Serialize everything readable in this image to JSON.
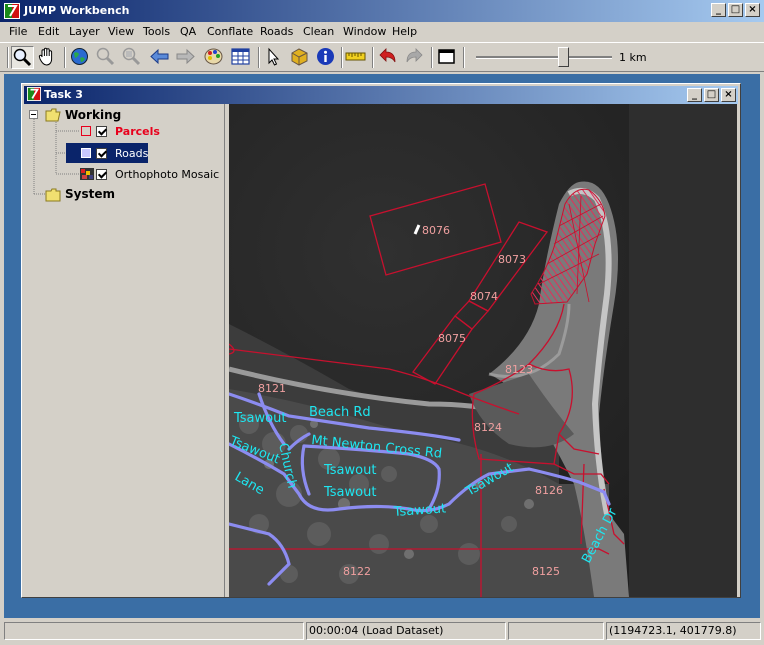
{
  "app": {
    "title": "JUMP Workbench",
    "window_buttons": [
      "_",
      "□",
      "×"
    ]
  },
  "menu": [
    "File",
    "Edit",
    "Layer",
    "View",
    "Tools",
    "QA",
    "Conflate",
    "Roads",
    "Clean",
    "Window",
    "Help"
  ],
  "toolbar": {
    "buttons": [
      "zoom-in-icon",
      "pan-hand-icon",
      "globe-icon",
      "zoom-to-selected-icon",
      "zoom-to-layer-icon",
      "back-arrow-icon",
      "forward-arrow-icon",
      "layer-palette-icon",
      "attribute-table-icon",
      "select-arrow-icon",
      "feature-box-icon",
      "info-icon",
      "measure-ruler-icon",
      "undo-icon",
      "redo-icon",
      "window-icon"
    ],
    "scale_label": "1 km",
    "scale_slider_value": 0.67
  },
  "task": {
    "title": "Task 3",
    "categories": [
      {
        "name": "Working",
        "expanded": true,
        "layers": [
          {
            "name": "Parcels",
            "checked": true,
            "selected": false,
            "color": "#e8001c"
          },
          {
            "name": "Roads",
            "checked": true,
            "selected": true,
            "color": "#b4b4ff"
          },
          {
            "name": "Orthophoto Mosaic",
            "checked": true,
            "selected": false,
            "color": "#000000"
          }
        ]
      },
      {
        "name": "System",
        "expanded": false,
        "layers": []
      }
    ]
  },
  "map": {
    "parcel_labels": [
      "8076",
      "8073",
      "8074",
      "8075",
      "8123",
      "8121",
      "8124",
      "8126",
      "8122",
      "8125"
    ],
    "road_labels": [
      "Beach Rd",
      "Mt Newton Cross Rd",
      "Tsawout",
      "Tsawout",
      "Tsawout",
      "Tsawout",
      "Tsawout",
      "Tsawout",
      "Beach Dr",
      "Lane",
      "Church"
    ],
    "parcel_color": "#c8102e",
    "road_color": "#8c8cf0",
    "road_label_color": "#1ee6f0"
  },
  "status": {
    "panel1": "",
    "panel2": "00:00:04 (Load Dataset)",
    "panel3": "",
    "panel4": "(1194723.1, 401779.8)"
  }
}
